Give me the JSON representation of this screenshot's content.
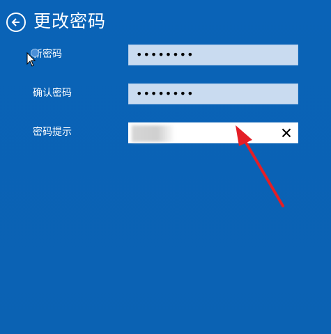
{
  "header": {
    "title": "更改密码",
    "back_icon": "arrow-left-circle-icon"
  },
  "form": {
    "new_password": {
      "label": "新密码",
      "masked_value": "••••••••"
    },
    "confirm_password": {
      "label": "确认密码",
      "masked_value": "••••••••"
    },
    "password_hint": {
      "label": "密码提示",
      "value": "",
      "clear_icon": "close-icon"
    }
  },
  "colors": {
    "background": "#0b63b6",
    "filled_field": "#c9dbf0",
    "active_field": "#ffffff",
    "annotation_arrow": "#e41e26"
  }
}
